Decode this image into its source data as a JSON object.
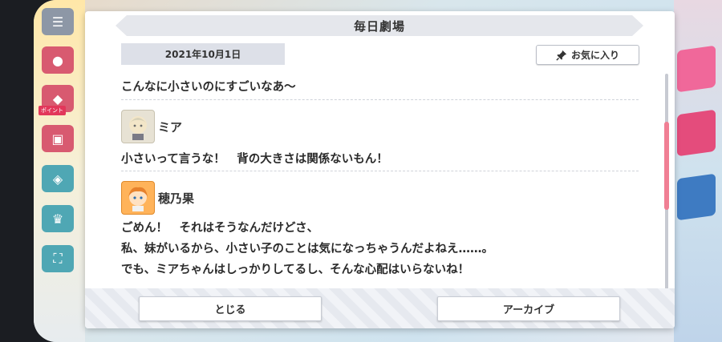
{
  "dialog": {
    "title": "毎日劇場",
    "date": "2021年10月1日",
    "favorite_label": "お気に入り",
    "favorite_icon": "pin-icon"
  },
  "story": {
    "intro_line": "こんなに小さいのにすごいなあ〜",
    "entries": [
      {
        "speaker": "ミア",
        "lines": [
          "小さいって言うな！　背の大きさは関係ないもん！"
        ]
      },
      {
        "speaker": "穂乃果",
        "lines": [
          "ごめん！　それはそうなんだけどさ、",
          "私、妹がいるから、小さい子のことは気になっちゃうんだよねえ……。",
          "でも、ミアちゃんはしっかりしてるし、そんな心配はいらないね！"
        ]
      }
    ]
  },
  "footer": {
    "close_label": "とじる",
    "archive_label": "アーカイブ"
  },
  "side": {
    "rail_tag": "ポイント"
  },
  "colors": {
    "accent_pink": "#f07f94",
    "header_gray": "#e5e7ec"
  }
}
